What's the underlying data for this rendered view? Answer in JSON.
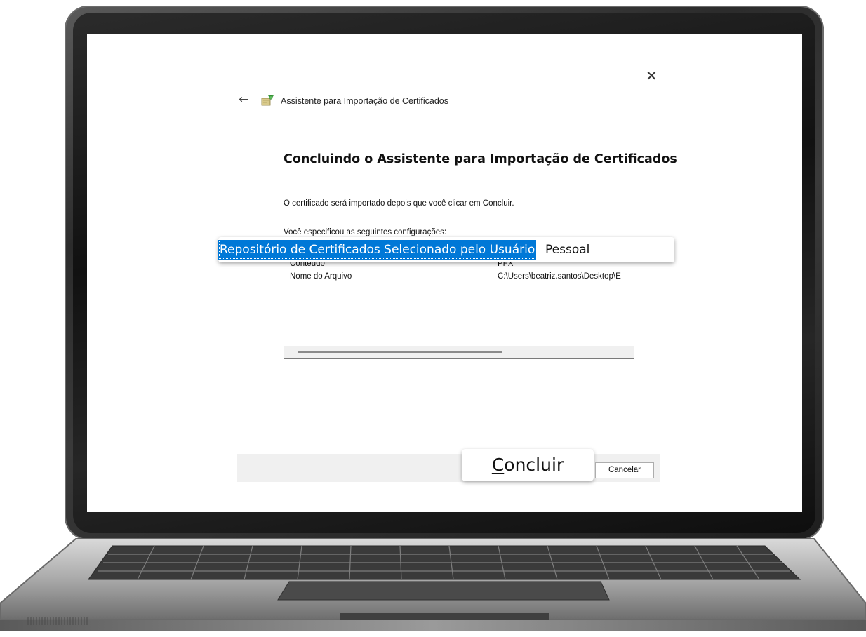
{
  "wizard": {
    "title": "Assistente para Importação de Certificados",
    "heading": "Concluindo o Assistente para Importação de Certificados",
    "intro": "O certificado será importado depois que você clicar em Concluir.",
    "settings_caption": "Você especificou as seguintes configurações:",
    "close_glyph": "✕",
    "back_glyph": "←"
  },
  "settings": {
    "rows": [
      {
        "key": "Conteúdo",
        "value": "PFX"
      },
      {
        "key": "Nome do Arquivo",
        "value": "C:\\Users\\beatriz.santos\\Desktop\\E"
      }
    ],
    "highlighted": {
      "key": "Repositório de Certificados Selecionado pelo Usuário",
      "value": "Pessoal"
    }
  },
  "buttons": {
    "finish_first": "C",
    "finish_rest": "oncluir",
    "cancel": "Cancelar"
  },
  "colors": {
    "selection": "#0078d7",
    "footer": "#f0f0f0"
  },
  "icons": {
    "wizard": "certificate-wizard-icon",
    "back": "back-arrow-icon",
    "close": "close-icon"
  }
}
